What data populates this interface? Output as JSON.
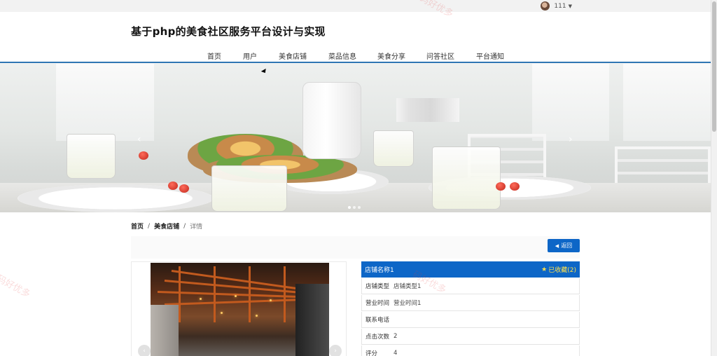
{
  "topbar": {
    "username": "111"
  },
  "header": {
    "site_title": "基于php的美食社区服务平台设计与实现"
  },
  "nav": {
    "items": [
      {
        "label": "首页"
      },
      {
        "label": "用户"
      },
      {
        "label": "美食店铺"
      },
      {
        "label": "菜品信息"
      },
      {
        "label": "美食分享"
      },
      {
        "label": "问答社区"
      },
      {
        "label": "平台通知"
      }
    ]
  },
  "breadcrumb": {
    "home": "首页",
    "section": "美食店铺",
    "current": "详情"
  },
  "actions": {
    "back_label": "返回"
  },
  "shop": {
    "name": "店铺名称1",
    "favorite": "已收藏(2)",
    "fields": [
      {
        "key": "店铺类型",
        "value": "店铺类型1"
      },
      {
        "key": "营业时间",
        "value": "营业时间1"
      },
      {
        "key": "联系电话",
        "value": ""
      },
      {
        "key": "点击次数",
        "value": "2"
      },
      {
        "key": "评分",
        "value": "4"
      }
    ]
  },
  "watermarks": [
    "码好优多",
    "码好优多",
    "码好优多"
  ],
  "colors": {
    "primary": "#0d66c7",
    "nav_line": "#2f76b3",
    "favorite": "#ffe14d"
  }
}
